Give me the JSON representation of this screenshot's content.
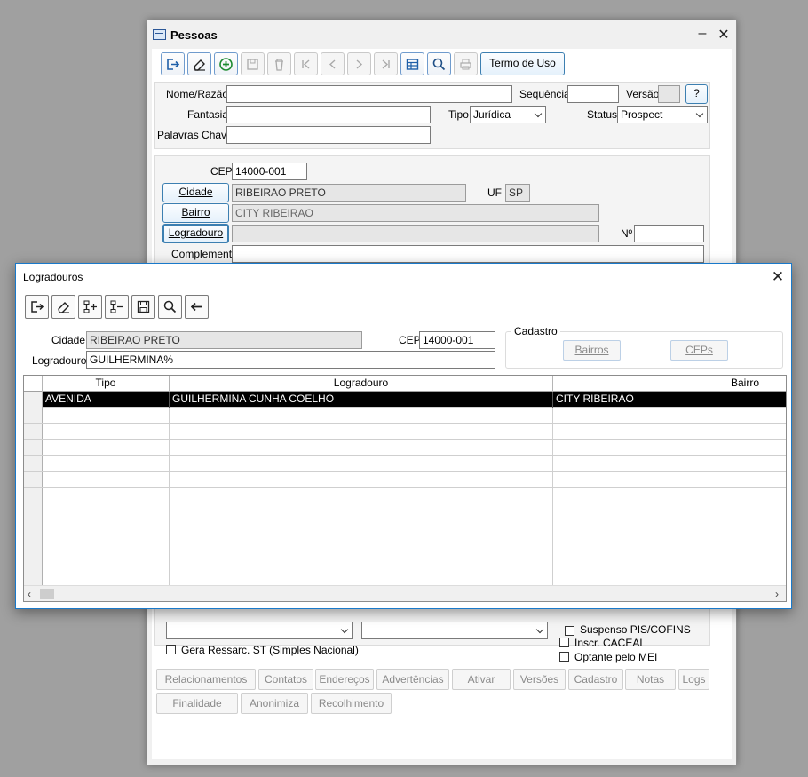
{
  "pessoas": {
    "title": "Pessoas",
    "toolbar": {
      "icons": [
        "exit-icon",
        "eraser-icon",
        "add-icon",
        "save-icon",
        "delete-icon",
        "first-icon",
        "prev-icon",
        "next-icon",
        "last-icon",
        "table-icon",
        "search-icon",
        "print-icon"
      ],
      "termo_label": "Termo de Uso"
    },
    "ident": {
      "nome_label": "Nome/Razão",
      "nome_value": "",
      "sequencia_label": "Sequência",
      "sequencia_value": "",
      "versao_label": "Versão",
      "versao_value": "",
      "help_label": "?",
      "fantasia_label": "Fantasia",
      "fantasia_value": "",
      "tipo_label": "Tipo",
      "tipo_value": "Jurídica",
      "status_label": "Status",
      "status_value": "Prospect",
      "palavras_label": "Palavras Chave",
      "palavras_value": ""
    },
    "endereco": {
      "cep_label": "CEP",
      "cep_value": "14000-001",
      "cidade_btn": "Cidade",
      "cidade_value": "RIBEIRAO PRETO",
      "uf_label": "UF",
      "uf_value": "SP",
      "bairro_btn": "Bairro",
      "bairro_value": "CITY RIBEIRAO",
      "logradouro_btn": "Logradouro",
      "logradouro_value": "",
      "numero_label": "Nº",
      "numero_value": "",
      "complemento_label": "Complemento",
      "complemento_value": ""
    },
    "lower": {
      "gera_ressarc_label": "Gera Ressarc. ST (Simples Nacional)",
      "partial_check_label": "Suspenso PIS/COFINS",
      "inscr_caceal_label": "Inscr. CACEAL",
      "optante_mei_label": "Optante pelo MEI"
    },
    "bottom_tabs_row1": [
      "Relacionamentos",
      "Contatos",
      "Endereços",
      "Advertências",
      "Ativar",
      "Versões",
      "Cadastro",
      "Notas",
      "Logs"
    ],
    "bottom_tabs_row2": [
      "Finalidade",
      "Anonimiza",
      "Recolhimento"
    ]
  },
  "logradouros": {
    "title": "Logradouros",
    "toolbar": {
      "icons": [
        "exit-icon",
        "eraser-icon",
        "insert-row-icon",
        "remove-row-icon",
        "save-icon",
        "search-icon",
        "back-arrow-icon"
      ]
    },
    "cidade_label": "Cidade",
    "cidade_value": "RIBEIRAO PRETO",
    "cep_label": "CEP",
    "cep_value": "14000-001",
    "logradouro_label": "Logradouro",
    "logradouro_value": "GUILHERMINA%",
    "cadastro_group": "Cadastro",
    "bairros_btn": "Bairros",
    "ceps_btn": "CEPs",
    "grid": {
      "columns": [
        "Tipo",
        "Logradouro",
        "Bairro"
      ],
      "rows": [
        {
          "tipo": "AVENIDA",
          "logradouro": "GUILHERMINA CUNHA COELHO",
          "bairro": "CITY RIBEIRAO"
        }
      ]
    }
  }
}
